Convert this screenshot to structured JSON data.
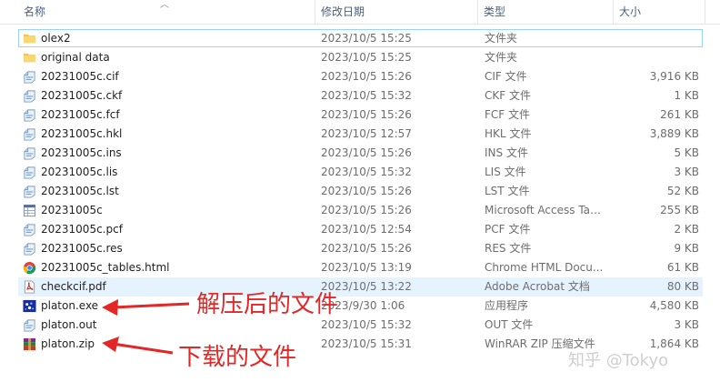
{
  "header": {
    "name": "名称",
    "date": "修改日期",
    "type": "类型",
    "size": "大小"
  },
  "files": [
    {
      "name": "olex2",
      "date": "2023/10/5 15:25",
      "type": "文件夹",
      "size": "",
      "icon": "folder-icon"
    },
    {
      "name": "original data",
      "date": "2023/10/5 15:25",
      "type": "文件夹",
      "size": "",
      "icon": "folder-icon"
    },
    {
      "name": "20231005c.cif",
      "date": "2023/10/5 15:26",
      "type": "CIF 文件",
      "size": "3,916 KB",
      "icon": "generic-file-icon"
    },
    {
      "name": "20231005c.ckf",
      "date": "2023/10/5 15:32",
      "type": "CKF 文件",
      "size": "1 KB",
      "icon": "generic-file-icon"
    },
    {
      "name": "20231005c.fcf",
      "date": "2023/10/5 15:26",
      "type": "FCF 文件",
      "size": "261 KB",
      "icon": "generic-file-icon"
    },
    {
      "name": "20231005c.hkl",
      "date": "2023/10/5 12:57",
      "type": "HKL 文件",
      "size": "3,889 KB",
      "icon": "generic-file-icon"
    },
    {
      "name": "20231005c.ins",
      "date": "2023/10/5 15:26",
      "type": "INS 文件",
      "size": "5 KB",
      "icon": "generic-file-icon"
    },
    {
      "name": "20231005c.lis",
      "date": "2023/10/5 15:32",
      "type": "LIS 文件",
      "size": "3 KB",
      "icon": "generic-file-icon"
    },
    {
      "name": "20231005c.lst",
      "date": "2023/10/5 15:26",
      "type": "LST 文件",
      "size": "52 KB",
      "icon": "generic-file-icon"
    },
    {
      "name": "20231005c",
      "date": "2023/10/5 15:26",
      "type": "Microsoft Access Tab...",
      "size": "255 KB",
      "icon": "access-table-icon"
    },
    {
      "name": "20231005c.pcf",
      "date": "2023/10/5 12:54",
      "type": "PCF 文件",
      "size": "2 KB",
      "icon": "generic-file-icon"
    },
    {
      "name": "20231005c.res",
      "date": "2023/10/5 15:26",
      "type": "RES 文件",
      "size": "9 KB",
      "icon": "generic-file-icon"
    },
    {
      "name": "20231005c_tables.html",
      "date": "2023/10/5 13:19",
      "type": "Chrome HTML Docu...",
      "size": "61 KB",
      "icon": "chrome-icon"
    },
    {
      "name": "checkcif.pdf",
      "date": "2023/10/5 13:22",
      "type": "Adobe Acrobat 文档",
      "size": "80 KB",
      "icon": "pdf-icon"
    },
    {
      "name": "platon.exe",
      "date": "2023/9/30 1:06",
      "type": "应用程序",
      "size": "4,580 KB",
      "icon": "exe-icon"
    },
    {
      "name": "platon.out",
      "date": "2023/10/5 15:32",
      "type": "OUT 文件",
      "size": "3 KB",
      "icon": "generic-file-icon"
    },
    {
      "name": "platon.zip",
      "date": "2023/10/5 15:31",
      "type": "WinRAR ZIP 压缩文件",
      "size": "1,864 KB",
      "icon": "winrar-icon"
    }
  ],
  "annotations": {
    "extracted": "解压后的文件",
    "downloaded": "下载的文件",
    "color": "#e32626"
  },
  "watermark": "知乎 @Tokyo",
  "colors": {
    "selection_border": "#99d1ff",
    "hover_bg": "#e5f3ff",
    "folder": "#f3c44e"
  }
}
